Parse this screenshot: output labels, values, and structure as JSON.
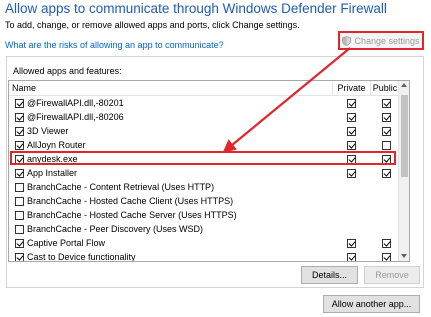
{
  "header": {
    "title": "Allow apps to communicate through Windows Defender Firewall",
    "subtitle": "To add, change, or remove allowed apps and ports, click Change settings.",
    "risk_link": "What are the risks of allowing an app to communicate?",
    "change_settings_label": "Change settings",
    "change_settings_icon": "shield-icon"
  },
  "group": {
    "label": "Allowed apps and features:"
  },
  "list": {
    "columns": {
      "name": "Name",
      "private": "Private",
      "public": "Public"
    },
    "rows": [
      {
        "name": "@FirewallAPI.dll,-80201",
        "enabled": true,
        "private": true,
        "public": true
      },
      {
        "name": "@FirewallAPI.dll,-80206",
        "enabled": true,
        "private": true,
        "public": true
      },
      {
        "name": "3D Viewer",
        "enabled": true,
        "private": true,
        "public": true
      },
      {
        "name": "AllJoyn Router",
        "enabled": true,
        "private": true,
        "public": false
      },
      {
        "name": "anydesk.exe",
        "enabled": true,
        "private": true,
        "public": true
      },
      {
        "name": "App Installer",
        "enabled": true,
        "private": true,
        "public": true
      },
      {
        "name": "BranchCache - Content Retrieval (Uses HTTP)",
        "enabled": false,
        "private": false,
        "public": false
      },
      {
        "name": "BranchCache - Hosted Cache Client (Uses HTTPS)",
        "enabled": false,
        "private": false,
        "public": false
      },
      {
        "name": "BranchCache - Hosted Cache Server (Uses HTTPS)",
        "enabled": false,
        "private": false,
        "public": false
      },
      {
        "name": "BranchCache - Peer Discovery (Uses WSD)",
        "enabled": false,
        "private": false,
        "public": false
      },
      {
        "name": "Captive Portal Flow",
        "enabled": true,
        "private": true,
        "public": true
      },
      {
        "name": "Cast to Device functionality",
        "enabled": true,
        "private": true,
        "public": true
      }
    ]
  },
  "buttons": {
    "details": "Details...",
    "remove": "Remove",
    "allow_another": "Allow another app..."
  },
  "colors": {
    "title": "#1e5cb3",
    "link": "#0066cc",
    "annotation": "#e0262d"
  }
}
